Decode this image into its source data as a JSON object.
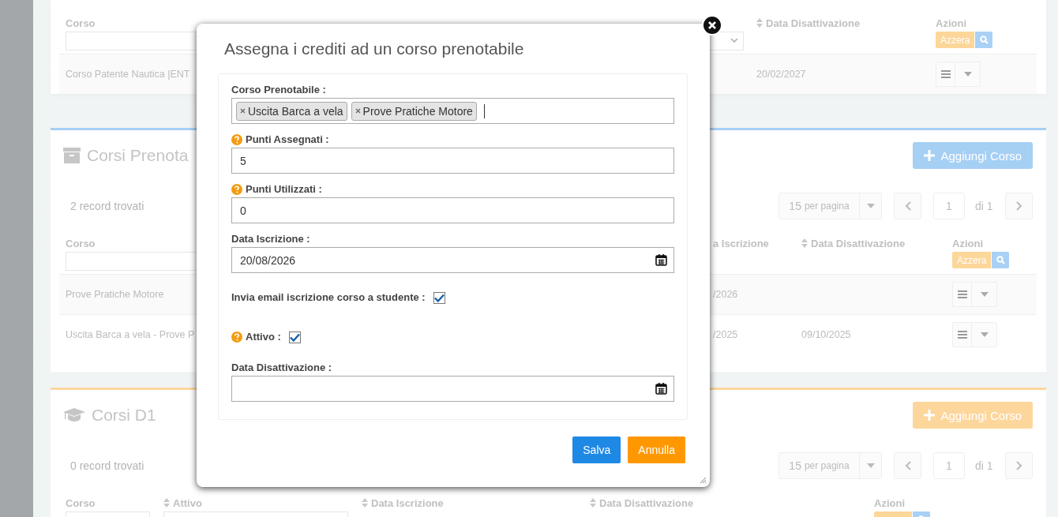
{
  "panels": [
    {
      "columns": [
        {
          "kind": "course",
          "label": "Corso"
        },
        {
          "kind": "enrolled"
        },
        {
          "kind": "active"
        },
        {
          "kind": "deactivated",
          "label": "Data Disattivazione"
        },
        {
          "kind": "actions",
          "label": "Azioni",
          "reset": "Azzera"
        }
      ],
      "rows": [
        {
          "course": "Corso Patente Nautica |ENT",
          "deactivated": "20/02/2027"
        }
      ]
    },
    {
      "title": "Corsi Prenota",
      "color": "#a6cff4",
      "add_button": "Aggiungi Corso",
      "record_count": "2 record trovati",
      "pagination": {
        "per_page": "15",
        "per_page_label": "per pagina",
        "page": "1",
        "of": "di 1"
      },
      "columns": [
        {
          "kind": "course",
          "label": "Corso"
        },
        {
          "kind": "enrolled",
          "label": "a Iscrizione"
        },
        {
          "kind": "deactivated",
          "label": "Data Disattivazione"
        },
        {
          "kind": "actions",
          "label": "Azioni",
          "reset": "Azzera"
        }
      ],
      "rows": [
        {
          "course": "Prove Pratiche Motore",
          "enrolled": "/2026"
        },
        {
          "course": "Uscita Barca a vela - Prove P",
          "enrolled": "/2025",
          "deactivated": "09/10/2025"
        }
      ]
    },
    {
      "title": "Corsi D1",
      "color": "#fdd69c",
      "add_button": "Aggiungi Corso",
      "record_count": "0 record trovati",
      "pagination": {
        "per_page": "15",
        "per_page_label": "per pagina",
        "page": "1",
        "of": "di 1"
      },
      "columns": [
        {
          "kind": "course",
          "label": "Corso"
        },
        {
          "kind": "active",
          "label": "Attivo"
        },
        {
          "kind": "enrolled",
          "label": "Data Iscrizione"
        },
        {
          "kind": "deactivated",
          "label": "Data Disattivazione"
        },
        {
          "kind": "actions",
          "label": "Azioni"
        }
      ]
    }
  ],
  "dialog": {
    "title": "Assegna i crediti ad un corso prenotabile",
    "fields": [
      {
        "kind": "tags",
        "label": "Corso Prenotabile :",
        "help": false,
        "tags": [
          "Uscita Barca a vela",
          "Prove Pratiche Motore"
        ]
      },
      {
        "kind": "text",
        "label": "Punti Assegnati :",
        "help": true,
        "value": "5"
      },
      {
        "kind": "text",
        "label": "Punti Utilizzati :",
        "help": true,
        "value": "0"
      },
      {
        "kind": "date",
        "label": "Data Iscrizione :",
        "help": false,
        "value": "20/08/2026"
      },
      {
        "kind": "checkbox",
        "label": "Invia email iscrizione corso a studente :",
        "help": false,
        "checked": true
      },
      {
        "kind": "checkbox",
        "label": "Attivo :",
        "help": true,
        "checked": true
      },
      {
        "kind": "date",
        "label": "Data Disattivazione :",
        "help": false
      }
    ],
    "buttons": [
      {
        "label": "Salva",
        "kind": "primary"
      },
      {
        "label": "Annulla",
        "kind": "cancel"
      }
    ]
  }
}
